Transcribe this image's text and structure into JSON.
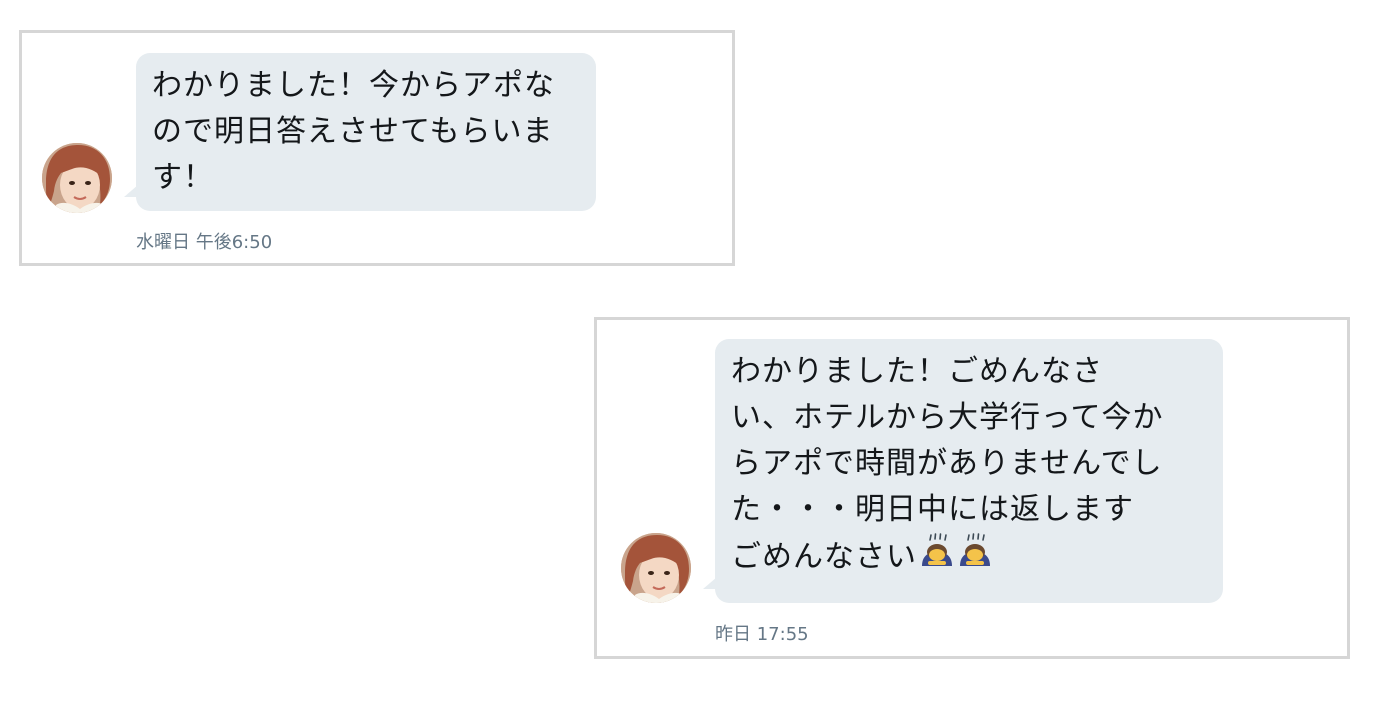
{
  "messages": [
    {
      "lines": [
        "わかりました！今からアポな",
        "ので明日答えさせてもらいま",
        "す！"
      ],
      "timestamp": "水曜日 午後6:50"
    },
    {
      "lines": [
        "わかりました！ごめんなさ",
        "い、ホテルから大学行って今か",
        "らアポで時間がありませんでし",
        "た・・・明日中には返します",
        "ごめんなさい"
      ],
      "emoji": [
        "person-bowing-icon",
        "person-bowing-icon"
      ],
      "timestamp": "昨日 17:55"
    }
  ],
  "colors": {
    "bubble": "#e6ecf0",
    "text": "#14171a",
    "timestamp": "#657786",
    "card_border": "#d6d6d6"
  }
}
